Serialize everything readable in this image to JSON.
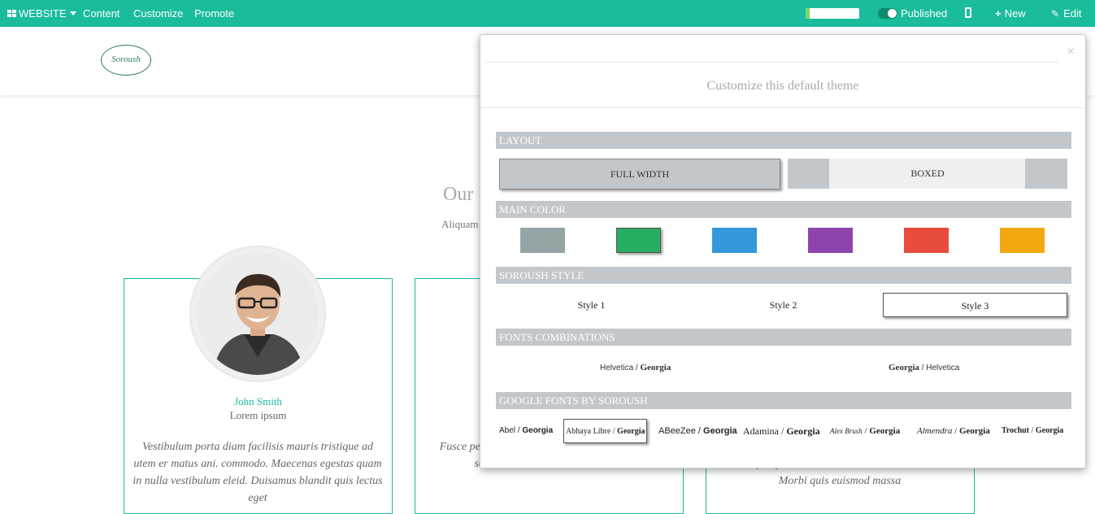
{
  "topbar": {
    "website_label": "WEBSITE",
    "content_label": "Content",
    "customize_label": "Customize",
    "promote_label": "Promote",
    "progress_fraction": 0.08,
    "published_label": "Published",
    "new_label": "New",
    "edit_label": "Edit",
    "bg_color": "#1abc9c"
  },
  "header": {
    "logo_text": "Soroush"
  },
  "page": {
    "title_fragment": "Our",
    "subtitle_fragment": "Aliquam",
    "team": [
      {
        "name": "John Smith",
        "role": "Lorem ipsum",
        "quote": "Vestibulum porta diam facilisis mauris tristique ad utem er matus ani. commodo. Maecenas egestas quam in nulla vestibulum eleid. Duisamus blandit quis lectus eget"
      },
      {
        "quote": "Fusce pe Pellent luctus neque saat ullamcorper, sollicitudin lacus in, varius risus"
      },
      {
        "quote": "scelerisque ipsum sem, nec sodales arcu mattis vitae. Morbi quis euismod massa"
      }
    ]
  },
  "modal": {
    "title": "Customize this default theme",
    "close_glyph": "×",
    "sections": {
      "layout": "LAYOUT",
      "main_color": "MAIN COLOR",
      "soroush_style": "SOROUSH STYLE",
      "fonts_combinations": "FONTS COMBINATIONS",
      "google_fonts": "GOOGLE FONTS BY SOROUSH"
    },
    "layout_options": {
      "full_width": "FULL WIDTH",
      "boxed": "BOXED"
    },
    "colors": [
      "#95a5a6",
      "#27ae60",
      "#3498db",
      "#8e44ad",
      "#e74c3c",
      "#f1a90f"
    ],
    "styles": [
      "Style 1",
      "Style 2",
      "Style 3"
    ],
    "font_combinations": [
      {
        "first": "Helvetica",
        "sep": " / ",
        "second": "Georgia"
      },
      {
        "first": "Georgia",
        "sep": " / ",
        "second": "Helvetica"
      }
    ],
    "google_fonts": [
      {
        "font": "Abel",
        "sep": " / ",
        "pair": "Georgia"
      },
      {
        "font": "Abhaya Libre",
        "sep": " / ",
        "pair": "Georgia"
      },
      {
        "font": "ABeeZee",
        "sep": " / ",
        "pair": "Georgia"
      },
      {
        "font": "Adamina",
        "sep": " / ",
        "pair": "Georgia"
      },
      {
        "font": "Alex Brush",
        "sep": " / ",
        "pair": "Georgia"
      },
      {
        "font": "Almendra",
        "sep": " / ",
        "pair": "Georgia"
      },
      {
        "font": "Trochut",
        "sep": " / ",
        "pair": "Georgia"
      }
    ]
  }
}
